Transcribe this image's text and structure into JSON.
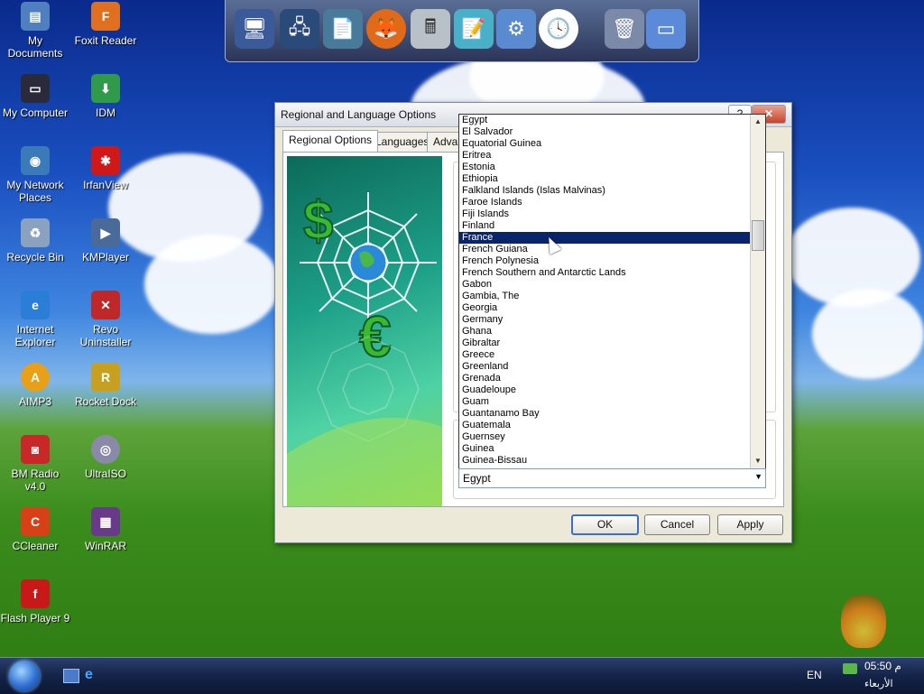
{
  "desktop": {
    "icons": [
      {
        "label": "My Documents",
        "icon": "folder-docs-icon",
        "color": "#4f7fbf"
      },
      {
        "label": "Foxit Reader",
        "icon": "foxit-icon",
        "color": "#e07020"
      },
      {
        "label": "My Computer",
        "icon": "monitor-icon",
        "color": "#2a2a3a"
      },
      {
        "label": "IDM",
        "icon": "idm-icon",
        "color": "#2f9a4a"
      },
      {
        "label": "My Network Places",
        "icon": "network-icon",
        "color": "#3a7ab8"
      },
      {
        "label": "IrfanView",
        "icon": "irfanview-icon",
        "color": "#d01818"
      },
      {
        "label": "Recycle Bin",
        "icon": "recycle-bin-icon",
        "color": "#8aa2c0"
      },
      {
        "label": "KMPlayer",
        "icon": "kmplayer-icon",
        "color": "#4a6a9a"
      },
      {
        "label": "Internet Explorer",
        "icon": "ie-icon",
        "color": "#2a7ed8"
      },
      {
        "label": "Revo Uninstaller",
        "icon": "revo-icon",
        "color": "#c02828"
      },
      {
        "label": "AIMP3",
        "icon": "aimp-icon",
        "color": "#e8a018"
      },
      {
        "label": "Rocket Dock",
        "icon": "rocketdock-icon",
        "color": "#c8a020"
      },
      {
        "label": "BM Radio v4.0",
        "icon": "radio-icon",
        "color": "#c82828"
      },
      {
        "label": "UltraISO",
        "icon": "disc-icon",
        "color": "#8a8aa8"
      },
      {
        "label": "CCleaner",
        "icon": "ccleaner-icon",
        "color": "#d84018"
      },
      {
        "label": "WinRAR",
        "icon": "winrar-icon",
        "color": "#6a3a8a"
      },
      {
        "label": "Flash Player 9",
        "icon": "flash-icon",
        "color": "#c81818"
      }
    ]
  },
  "dock": {
    "items": [
      {
        "icon": "my-computer-dock-icon",
        "glyph": "🖥"
      },
      {
        "icon": "network-dock-icon",
        "glyph": "🖧"
      },
      {
        "icon": "documents-dock-icon",
        "glyph": "📄"
      },
      {
        "icon": "firefox-dock-icon",
        "glyph": "🦊"
      },
      {
        "icon": "calculator-dock-icon",
        "glyph": "🖩"
      },
      {
        "icon": "notepad-dock-icon",
        "glyph": "📝"
      },
      {
        "icon": "control-panel-dock-icon",
        "glyph": "⚙"
      },
      {
        "icon": "clock-dock-icon",
        "glyph": "🕓"
      },
      {
        "icon": "recycle-bin-dock-icon",
        "glyph": "🗑"
      },
      {
        "icon": "desktop-dock-icon",
        "glyph": "▭"
      }
    ]
  },
  "window": {
    "title": "Regional and Language Options",
    "help_glyph": "?",
    "close_glyph": "✕",
    "tabs": [
      "Regional Options",
      "Languages",
      "Advan"
    ],
    "buttons": {
      "ok": "OK",
      "cancel": "Cancel",
      "apply": "Apply"
    }
  },
  "location_list": {
    "items": [
      "Egypt",
      "El Salvador",
      "Equatorial Guinea",
      "Eritrea",
      "Estonia",
      "Ethiopia",
      "Falkland Islands (Islas Malvinas)",
      "Faroe Islands",
      "Fiji Islands",
      "Finland",
      "France",
      "French Guiana",
      "French Polynesia",
      "French Southern and Antarctic Lands",
      "Gabon",
      "Gambia, The",
      "Georgia",
      "Germany",
      "Ghana",
      "Gibraltar",
      "Greece",
      "Greenland",
      "Grenada",
      "Guadeloupe",
      "Guam",
      "Guantanamo Bay",
      "Guatemala",
      "Guernsey",
      "Guinea",
      "Guinea-Bissau"
    ],
    "selected": "France",
    "combo_value": "Egypt"
  },
  "taskbar": {
    "language": "EN",
    "time": "05:50 م",
    "day": "الأربعاء"
  },
  "colors": {
    "selection": "#0a246a",
    "accent": "#3a6ec8"
  }
}
